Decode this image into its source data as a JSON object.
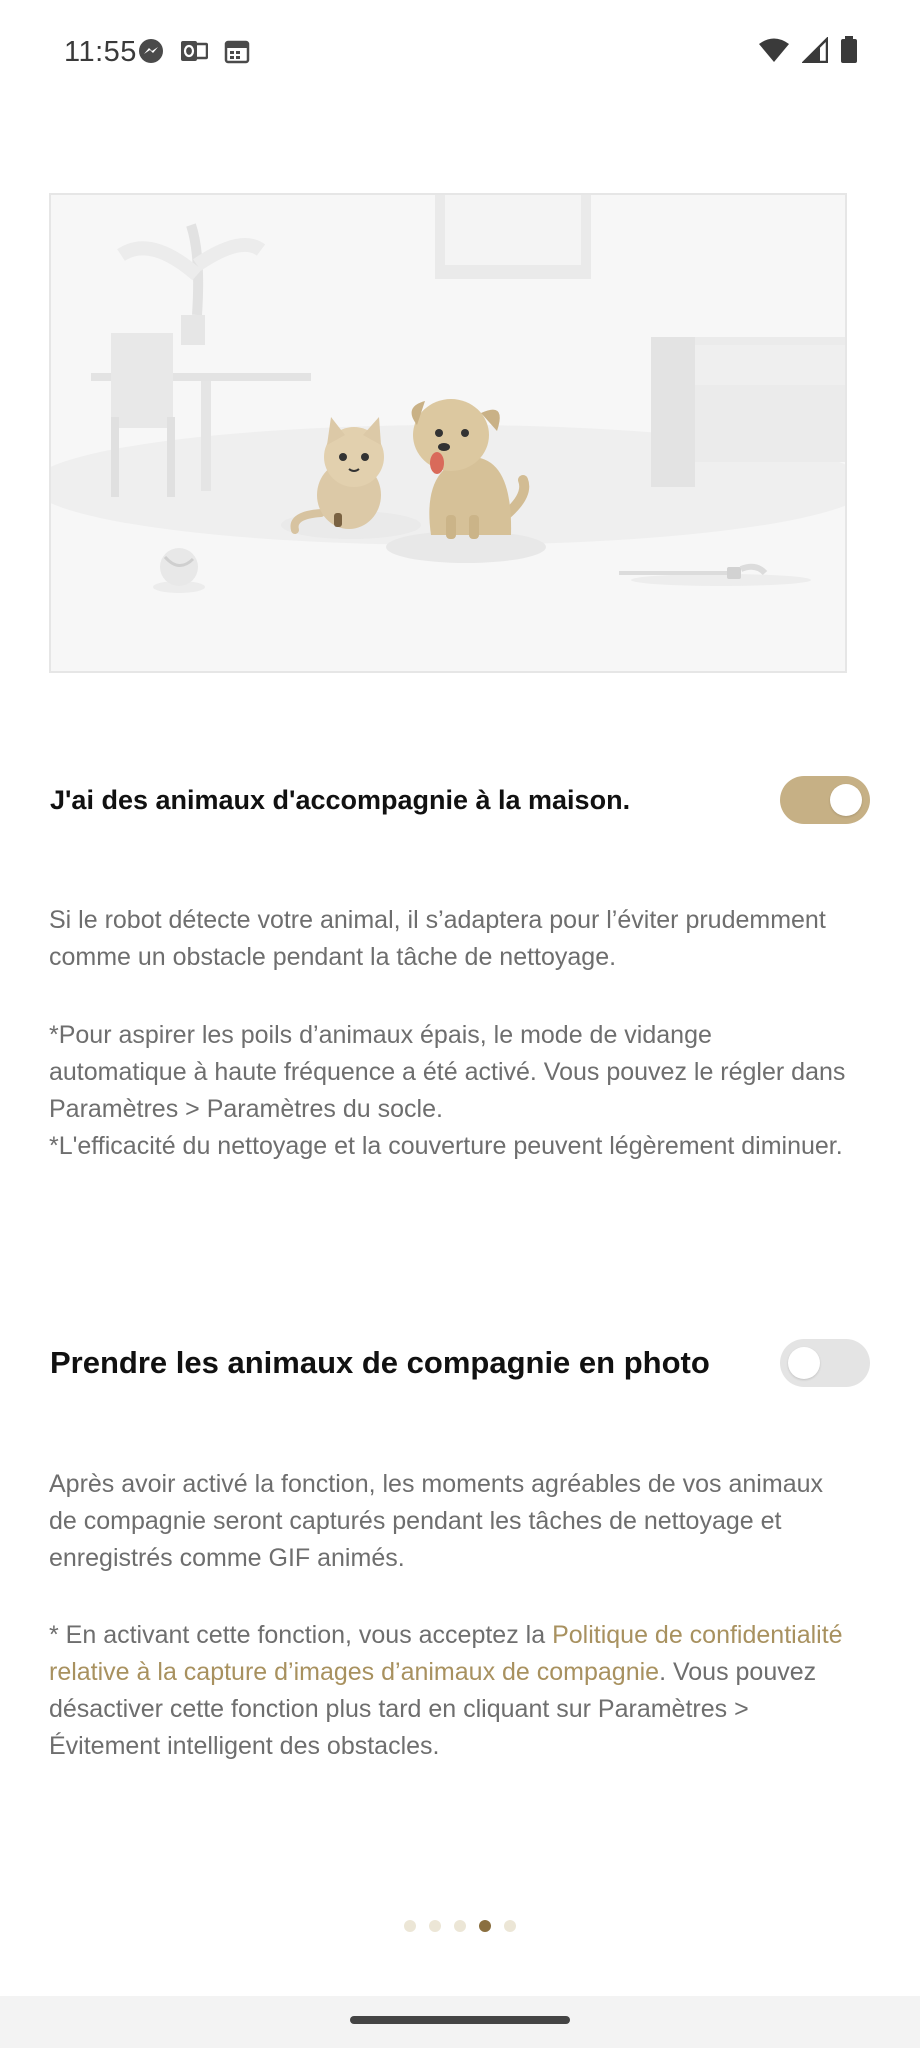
{
  "status_bar": {
    "time": "11:55",
    "left_icons": [
      "messenger-icon",
      "outlook-icon",
      "calendar-icon"
    ],
    "right_icons": [
      "wifi-icon",
      "cell-signal-icon",
      "battery-icon"
    ]
  },
  "illustration": {
    "description_icons": [
      "cat-icon",
      "dog-icon",
      "ball-icon",
      "cable-icon",
      "sofa-icon",
      "table-icon",
      "chair-icon",
      "plant-icon",
      "window-icon"
    ]
  },
  "pets_setting": {
    "title": "J'ai des animaux d'accompagnie à la maison.",
    "enabled": true,
    "desc1": "Si le robot détecte votre animal, il s’adaptera pour l’éviter prudemment comme un obstacle pendant la tâche de nettoyage.",
    "desc2_line1": "*Pour aspirer les poils d’animaux épais, le mode de vidange automatique à haute fréquence a été activé. Vous pouvez le régler dans Paramètres > Paramètres du socle.",
    "desc2_line2": "*L'efficacité du nettoyage et la couverture peuvent légèrement diminuer."
  },
  "photo_setting": {
    "title": "Prendre les animaux de compagnie en photo",
    "enabled": false,
    "desc1": "Après avoir activé la fonction, les moments agréables de vos animaux de compagnie seront capturés pendant les tâches de nettoyage et enregistrés comme GIF animés.",
    "desc2_prefix": "* En activant cette fonction, vous acceptez la ",
    "desc2_link": "Politique de confidentialité relative à la capture d’images d’animaux de compagnie",
    "desc2_suffix": ". Vous pouvez désactiver cette fonction plus tard en cliquant sur Paramètres > Évitement intelligent des obstacles."
  },
  "pager": {
    "total": 5,
    "current": 4
  },
  "colors": {
    "accent": "#c6b085",
    "link": "#a8915f",
    "dot_active": "#8a6f3f",
    "dot_inactive": "#ece6d6"
  }
}
